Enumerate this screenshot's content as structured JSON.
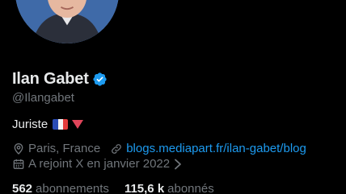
{
  "profile": {
    "display_name": "Ilan Gabet",
    "handle": "@Ilangabet",
    "bio": "Juriste",
    "location": "Paris, France",
    "website": "blogs.mediapart.fr/ilan-gabet/blog",
    "joined": "A rejoint X en janvier 2022",
    "following_count": "562",
    "following_label": "abonnements",
    "followers_count": "115,6 k",
    "followers_label": "abonnés"
  },
  "icons": {
    "verified": "verified-badge-icon",
    "flag": "france-flag-icon",
    "triangle": "red-triangle-icon",
    "location": "location-pin-icon",
    "link": "link-icon",
    "calendar": "calendar-icon",
    "chevron": "chevron-right-icon"
  },
  "colors": {
    "background": "#000000",
    "primary_text": "#e7e9ea",
    "secondary_text": "#71767b",
    "link": "#1d9bf0",
    "verified": "#1d9bf0",
    "triangle": "#e0455a"
  }
}
